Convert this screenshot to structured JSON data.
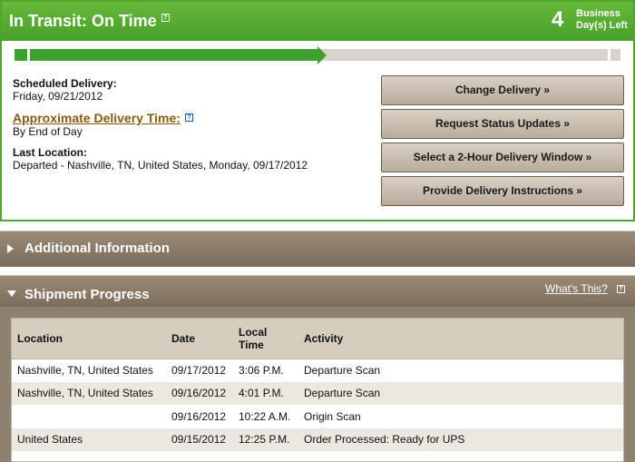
{
  "status": {
    "title": "In Transit: On Time",
    "help_glyph": "?",
    "days_count": "4",
    "days_label_line1": "Business",
    "days_label_line2": "Day(s) Left",
    "progress_fraction": 0.5
  },
  "details": {
    "scheduled_label": "Scheduled Delivery:",
    "scheduled_value": "Friday, 09/21/2012",
    "approx_label": "Approximate Delivery Time:",
    "approx_value": "By End of Day",
    "last_location_label": "Last Location:",
    "last_location_value": "Departed - Nashville, TN, United States, Monday, 09/17/2012"
  },
  "actions": {
    "change_delivery": "Change Delivery »",
    "request_updates": "Request Status Updates »",
    "delivery_window": "Select a 2-Hour Delivery Window »",
    "delivery_instructions": "Provide Delivery Instructions »"
  },
  "additional_info": {
    "title": "Additional Information"
  },
  "shipment_progress": {
    "title": "Shipment Progress",
    "whats_this": "What's This?",
    "columns": {
      "location": "Location",
      "date": "Date",
      "local_time_1": "Local",
      "local_time_2": "Time",
      "activity": "Activity"
    },
    "rows": [
      {
        "location": "Nashville, TN, United States",
        "date": "09/17/2012",
        "time": "3:06 P.M.",
        "activity": "Departure Scan"
      },
      {
        "location": "Nashville, TN, United States",
        "date": "09/16/2012",
        "time": "4:01 P.M.",
        "activity": "Departure Scan"
      },
      {
        "location": "",
        "date": "09/16/2012",
        "time": "10:22 A.M.",
        "activity": "Origin Scan"
      },
      {
        "location": "United States",
        "date": "09/15/2012",
        "time": "12:25 P.M.",
        "activity": "Order Processed: Ready for UPS"
      }
    ]
  },
  "colors": {
    "accent_green": "#4fa62d",
    "section_brown": "#8f8170",
    "link_brown": "#8a5a12"
  }
}
